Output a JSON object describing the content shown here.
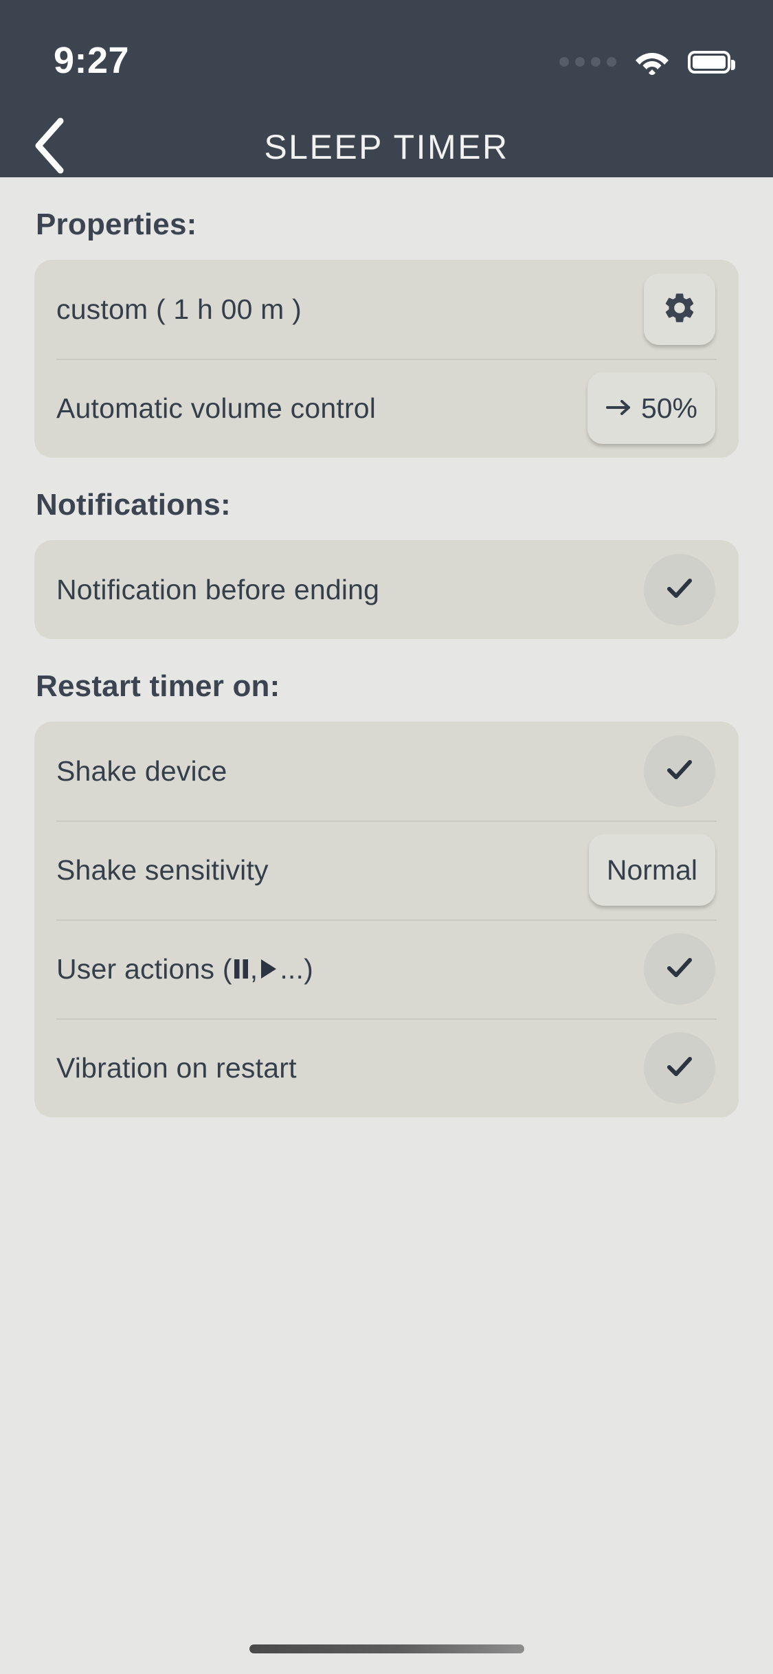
{
  "status_bar": {
    "time": "9:27",
    "signal_icon": "signal-dots-icon",
    "wifi_icon": "wifi-icon",
    "battery_icon": "battery-full-icon"
  },
  "header": {
    "back_icon": "chevron-left-icon",
    "title": "SLEEP TIMER"
  },
  "sections": [
    {
      "title": "Properties:",
      "rows": [
        {
          "label": "custom ( 1 h 00 m )",
          "control": "gear-button",
          "control_label": "",
          "icon": "gear-icon"
        },
        {
          "label": "Automatic volume control",
          "control": "value-pill",
          "control_label": "50%",
          "icon": "arrow-right-icon"
        }
      ]
    },
    {
      "title": "Notifications:",
      "rows": [
        {
          "label": "Notification before ending",
          "control": "check-toggle",
          "control_label": "",
          "icon": "check-icon"
        }
      ]
    },
    {
      "title": "Restart timer on:",
      "rows": [
        {
          "label": "Shake device",
          "control": "check-toggle",
          "control_label": "",
          "icon": "check-icon"
        },
        {
          "label": "Shake sensitivity",
          "control": "value-pill-text",
          "control_label": "Normal",
          "icon": ""
        },
        {
          "label": "User actions ( ",
          "label_suffix": "...)",
          "control": "check-toggle",
          "control_label": "",
          "icon": "check-icon",
          "inline_icons": [
            "pause-icon",
            "play-icon"
          ],
          "separator": " , "
        },
        {
          "label": "Vibration on restart",
          "control": "check-toggle",
          "control_label": "",
          "icon": "check-icon"
        }
      ]
    }
  ],
  "colors": {
    "statusbar_bg": "#3c4450",
    "page_bg": "#e6e6e4",
    "card_bg": "#d9d9d2",
    "text_dark": "#353f4b",
    "button_bg": "#dfdfda",
    "check_bg": "#cfd0c9"
  },
  "home_indicator": "home-indicator"
}
